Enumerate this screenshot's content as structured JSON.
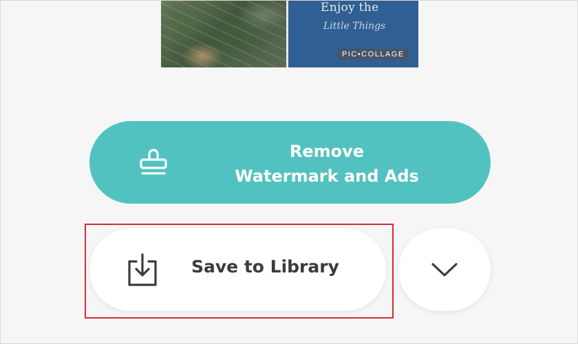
{
  "preview": {
    "title_line": "Enjoy the",
    "subtitle_line": "Little Things",
    "watermark": "PIC•COLLAGE"
  },
  "remove_button": {
    "line1": "Remove",
    "line2": "Watermark and Ads",
    "icon": "stamp-icon",
    "color": "#52c2c0"
  },
  "save_button": {
    "label": "Save to Library",
    "icon": "download-icon"
  },
  "more_button": {
    "icon": "chevron-down-icon"
  },
  "highlight_color": "#d32a35"
}
